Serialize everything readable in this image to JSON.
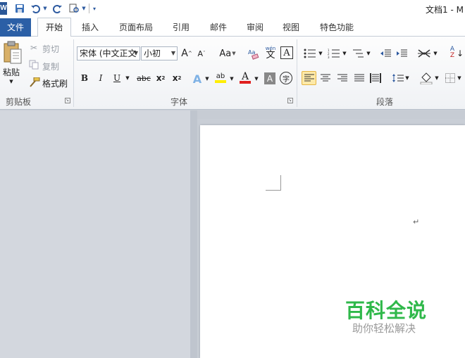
{
  "titlebar": {
    "app_icon": "W",
    "title": "文档1 - M",
    "qa_icons": [
      "save-icon",
      "undo-icon",
      "redo-icon",
      "print-preview-icon",
      "customize-icon"
    ]
  },
  "tabs": {
    "file": "文件",
    "items": [
      "开始",
      "插入",
      "页面布局",
      "引用",
      "邮件",
      "审阅",
      "视图",
      "特色功能"
    ],
    "active_index": 0
  },
  "clipboard": {
    "paste": "粘贴",
    "cut": "剪切",
    "copy": "复制",
    "format_painter": "格式刷",
    "group_label": "剪贴板"
  },
  "font": {
    "font_name": "宋体 (中文正文",
    "font_size": "小初",
    "grow": "A",
    "shrink": "A",
    "change_case": "Aa",
    "bold": "B",
    "italic": "I",
    "underline": "U",
    "strikethrough": "abc",
    "subscript": "x",
    "superscript": "x",
    "text_effect": "A",
    "highlight": "ab",
    "font_color": "A",
    "char_shading": "A",
    "enclose": "字",
    "phonetic": "wén",
    "phonetic_char": "文",
    "border_char": "A",
    "group_label": "字体"
  },
  "paragraph": {
    "group_label": "段落",
    "sort": "A↓Z"
  },
  "document": {
    "para_mark": "↵"
  },
  "watermark": {
    "title": "百科全说",
    "subtitle": "助你轻松解决"
  },
  "colors": {
    "file_tab": "#2b5fa6",
    "font_color_bar": "#e02020",
    "highlight_bar": "#ffee00",
    "watermark_green": "#2fb84a"
  }
}
